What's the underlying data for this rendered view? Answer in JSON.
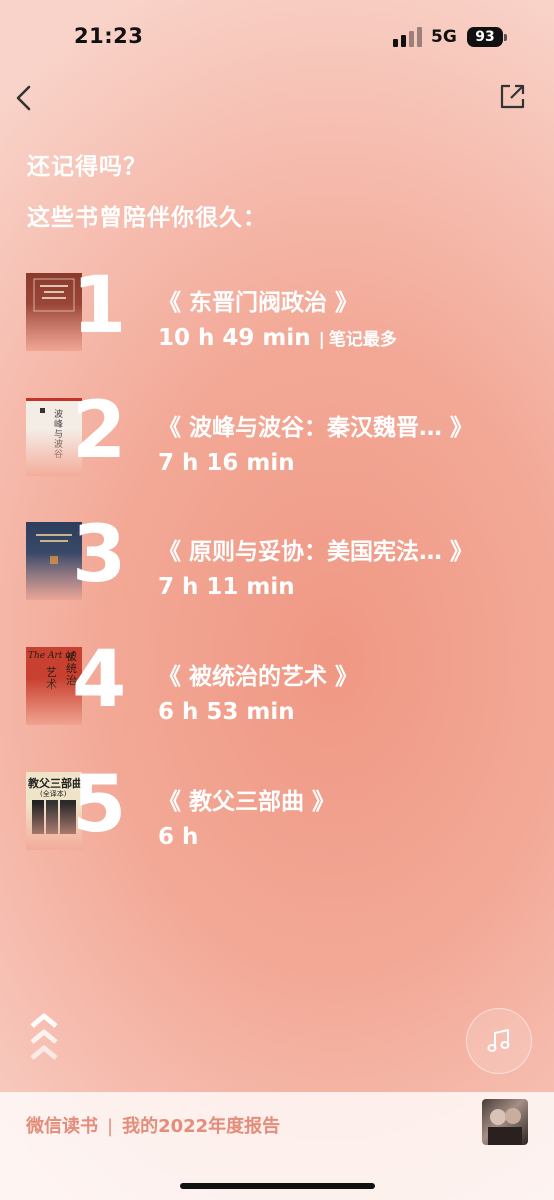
{
  "status": {
    "time": "21:23",
    "network": "5G",
    "battery": "93"
  },
  "heading": {
    "line1": "还记得吗？",
    "line2": "这些书曾陪伴你很久："
  },
  "books": [
    {
      "rank": "1",
      "title": "《 东晋门阀政治 》",
      "duration": "10 h 49 min",
      "separator": "|",
      "note": "笔记最多"
    },
    {
      "rank": "2",
      "title": "《 波峰与波谷：秦汉魏晋… 》",
      "duration": "7 h 16 min"
    },
    {
      "rank": "3",
      "title": "《 原则与妥协：美国宪法… 》",
      "duration": "7 h 11 min"
    },
    {
      "rank": "4",
      "title": "《 被统治的艺术 》",
      "duration": "6 h 53 min"
    },
    {
      "rank": "5",
      "title": "《 教父三部曲 》",
      "duration": "6 h"
    }
  ],
  "covers": {
    "book2_title": "波峰与波谷",
    "book4_en": "The Art of",
    "book4_zh": "被统治",
    "book4_zh2": "艺术",
    "book5_title": "教父三部曲",
    "book5_sub": "(全译本)"
  },
  "footer": {
    "app_name": "微信读书",
    "separator": "|",
    "report": "我的2022年度报告"
  },
  "icons": {
    "back": "chevron-left-icon",
    "share": "share-icon",
    "scroll": "double-chevron-up-icon",
    "music": "music-note-icon"
  },
  "colors": {
    "background": "#f3a997",
    "footer_text": "#e38d7a",
    "text": "#ffffff"
  }
}
